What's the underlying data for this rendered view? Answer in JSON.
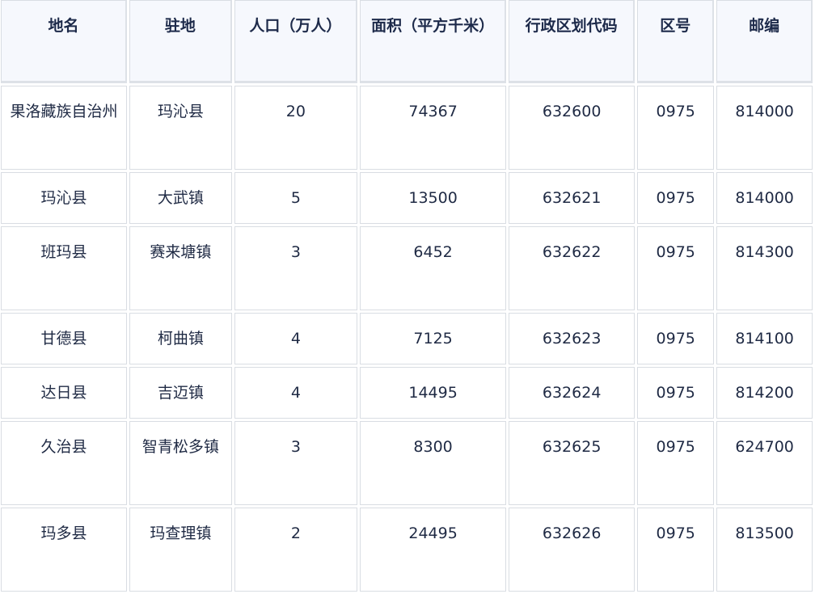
{
  "table": {
    "headers": [
      "地名",
      "驻地",
      "人口（万人）",
      "面积（平方千米）",
      "行政区划代码",
      "区号",
      "邮编"
    ],
    "rows": [
      [
        "果洛藏族自治州",
        "玛沁县",
        "20",
        "74367",
        "632600",
        "0975",
        "814000"
      ],
      [
        "玛沁县",
        "大武镇",
        "5",
        "13500",
        "632621",
        "0975",
        "814000"
      ],
      [
        "班玛县",
        "赛来塘镇",
        "3",
        "6452",
        "632622",
        "0975",
        "814300"
      ],
      [
        "甘德县",
        "柯曲镇",
        "4",
        "7125",
        "632623",
        "0975",
        "814100"
      ],
      [
        "达日县",
        "吉迈镇",
        "4",
        "14495",
        "632624",
        "0975",
        "814200"
      ],
      [
        "久治县",
        "智青松多镇",
        "3",
        "8300",
        "632625",
        "0975",
        "624700"
      ],
      [
        "玛多县",
        "玛查理镇",
        "2",
        "24495",
        "632626",
        "0975",
        "813500"
      ]
    ]
  }
}
